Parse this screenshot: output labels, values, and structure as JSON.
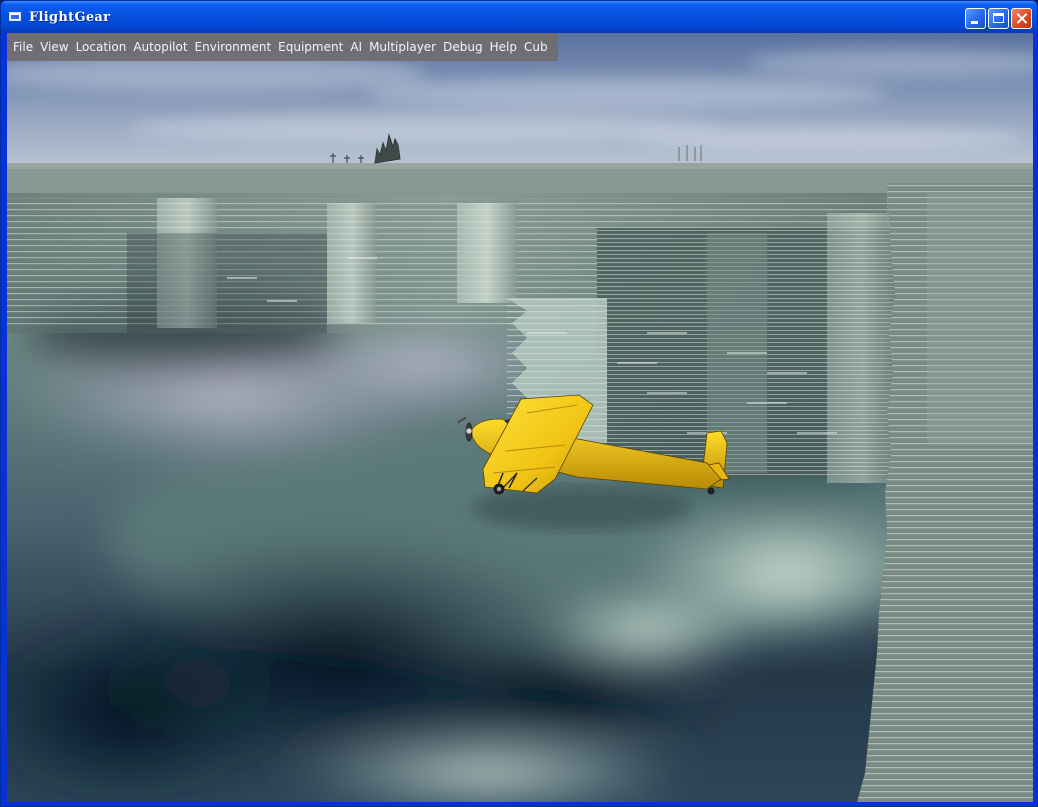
{
  "window": {
    "title": "FlightGear"
  },
  "menubar": {
    "items": [
      {
        "label": "File"
      },
      {
        "label": "View"
      },
      {
        "label": "Location"
      },
      {
        "label": "Autopilot"
      },
      {
        "label": "Environment"
      },
      {
        "label": "Equipment"
      },
      {
        "label": "AI"
      },
      {
        "label": "Multiplayer"
      },
      {
        "label": "Debug"
      },
      {
        "label": "Help"
      },
      {
        "label": "Cub"
      }
    ]
  },
  "colors": {
    "sky_top": "#5f7aa4",
    "sky_horizon": "#b6c2d2",
    "terrain_light": "#c4d6ce",
    "terrain_dark": "#10202e",
    "aircraft": "#f2cc18",
    "titlebar": "#0552e0",
    "menubar": "#706c70"
  }
}
